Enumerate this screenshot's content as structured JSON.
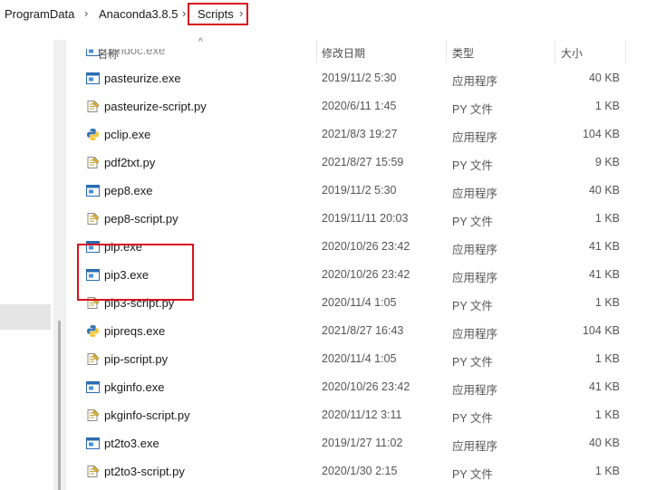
{
  "breadcrumb": {
    "items": [
      "ProgramData",
      "Anaconda3.8.5",
      "Scripts"
    ],
    "highlighted": "Scripts"
  },
  "columns": {
    "name": "名称",
    "date": "修改日期",
    "type": "类型",
    "size": "大小"
  },
  "colors": {
    "highlight": "#d9121e",
    "selected_nav": "#e5e5e5"
  },
  "icons": {
    "exe": "exe-window-icon",
    "py": "python-script-icon",
    "python_exe": "python-app-icon"
  },
  "files": [
    {
      "name": "pandoc.exe",
      "date": "",
      "type": "",
      "size": "",
      "icon": "exe"
    },
    {
      "name": "pasteurize.exe",
      "date": "2019/11/2 5:30",
      "type": "应用程序",
      "size": "40 KB",
      "icon": "exe"
    },
    {
      "name": "pasteurize-script.py",
      "date": "2020/6/11 1:45",
      "type": "PY 文件",
      "size": "1 KB",
      "icon": "py"
    },
    {
      "name": "pclip.exe",
      "date": "2021/8/3 19:27",
      "type": "应用程序",
      "size": "104 KB",
      "icon": "python_exe"
    },
    {
      "name": "pdf2txt.py",
      "date": "2021/8/27 15:59",
      "type": "PY 文件",
      "size": "9 KB",
      "icon": "py"
    },
    {
      "name": "pep8.exe",
      "date": "2019/11/2 5:30",
      "type": "应用程序",
      "size": "40 KB",
      "icon": "exe"
    },
    {
      "name": "pep8-script.py",
      "date": "2019/11/11 20:03",
      "type": "PY 文件",
      "size": "1 KB",
      "icon": "py"
    },
    {
      "name": "pip.exe",
      "date": "2020/10/26 23:42",
      "type": "应用程序",
      "size": "41 KB",
      "icon": "exe"
    },
    {
      "name": "pip3.exe",
      "date": "2020/10/26 23:42",
      "type": "应用程序",
      "size": "41 KB",
      "icon": "exe"
    },
    {
      "name": "pip3-script.py",
      "date": "2020/11/4 1:05",
      "type": "PY 文件",
      "size": "1 KB",
      "icon": "py"
    },
    {
      "name": "pipreqs.exe",
      "date": "2021/8/27 16:43",
      "type": "应用程序",
      "size": "104 KB",
      "icon": "python_exe"
    },
    {
      "name": "pip-script.py",
      "date": "2020/11/4 1:05",
      "type": "PY 文件",
      "size": "1 KB",
      "icon": "py"
    },
    {
      "name": "pkginfo.exe",
      "date": "2020/10/26 23:42",
      "type": "应用程序",
      "size": "41 KB",
      "icon": "exe"
    },
    {
      "name": "pkginfo-script.py",
      "date": "2020/11/12 3:11",
      "type": "PY 文件",
      "size": "1 KB",
      "icon": "py"
    },
    {
      "name": "pt2to3.exe",
      "date": "2019/1/27 11:02",
      "type": "应用程序",
      "size": "40 KB",
      "icon": "exe"
    },
    {
      "name": "pt2to3-script.py",
      "date": "2020/1/30 2:15",
      "type": "PY 文件",
      "size": "1 KB",
      "icon": "py"
    }
  ]
}
